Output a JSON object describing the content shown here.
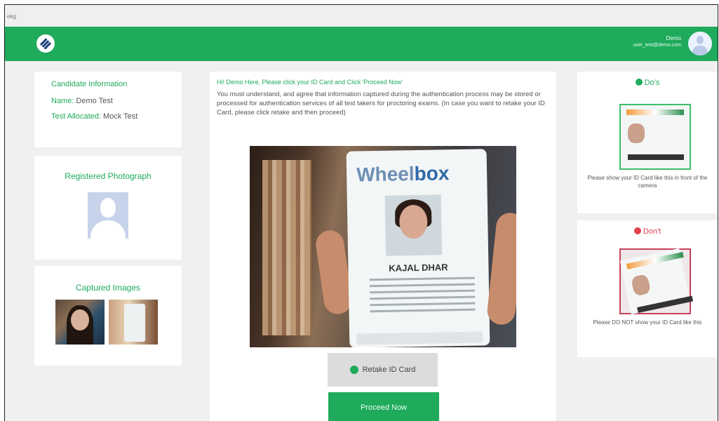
{
  "window": {
    "tag": "ekg"
  },
  "header": {
    "user_name": "Demo",
    "user_email": "user_test@demo.com",
    "brand_color": "#1faa5c"
  },
  "sidebar": {
    "candidate_title": "Candidate Information",
    "name_label": "Name:",
    "name_value": "Demo Test",
    "test_label": "Test Allocated:",
    "test_value": "Mock Test",
    "photo_title": "Registered Photograph",
    "captured_title": "Captured Images"
  },
  "main": {
    "headline": "Hi! Demo Here, Please click your ID Card and Click 'Proceed Now'",
    "description": "You must understand, and agree that information captured during the authentication process may be stored or processed for authentication services of all test takers for proctoring exams. (In case you want to retake your ID Card, please click retake and then proceed)",
    "id_card_brand_a": "Wheel",
    "id_card_brand_b": "box",
    "id_card_name": "KAJAL DHAR",
    "retake_label": "Retake ID Card",
    "proceed_label": "Proceed Now"
  },
  "guide": {
    "do_title": "Do's",
    "do_caption": "Please show your ID Card like this in front of the camera",
    "dont_title": "Don't",
    "dont_caption": "Please DO NOT show your ID Card like this",
    "do_color": "#1faa5c",
    "dont_color": "#e0424f"
  }
}
